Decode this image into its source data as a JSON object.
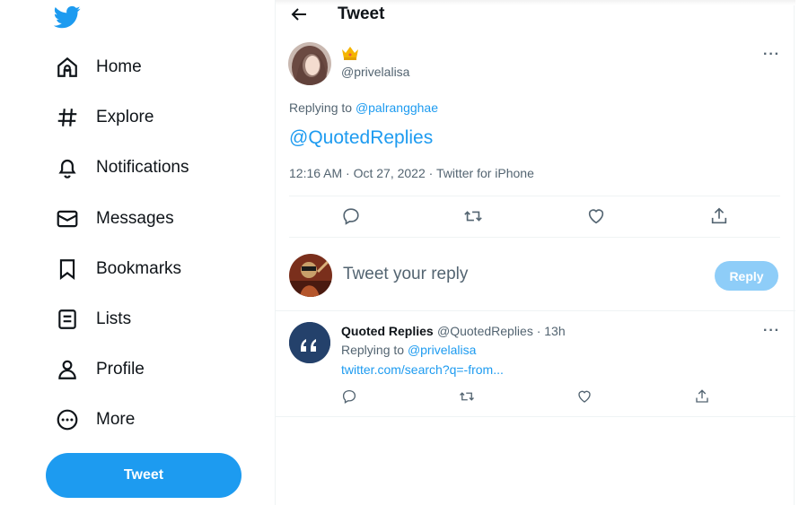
{
  "colors": {
    "brand": "#1d9bf0",
    "text": "#0f1419",
    "muted": "#536471",
    "reply_disabled": "#8ecdf8"
  },
  "sidebar": {
    "logo_icon": "twitter-bird-icon",
    "items": [
      {
        "label": "Home",
        "icon": "home-icon"
      },
      {
        "label": "Explore",
        "icon": "hashtag-icon"
      },
      {
        "label": "Notifications",
        "icon": "bell-icon"
      },
      {
        "label": "Messages",
        "icon": "envelope-icon"
      },
      {
        "label": "Bookmarks",
        "icon": "bookmark-icon"
      },
      {
        "label": "Lists",
        "icon": "list-icon"
      },
      {
        "label": "Profile",
        "icon": "person-icon"
      },
      {
        "label": "More",
        "icon": "more-circle-icon"
      }
    ],
    "tweet_button": "Tweet"
  },
  "header": {
    "back_icon": "back-arrow-icon",
    "title": "Tweet"
  },
  "tweet": {
    "display_name_emoji": "crown-emoji",
    "handle": "@privelalisa",
    "replying_prefix": "Replying to",
    "replying_to": "@palrangghae",
    "body": "@QuotedReplies",
    "timestamp": "12:16 AM · Oct 27, 2022 · Twitter for iPhone",
    "actions": [
      "reply-icon",
      "retweet-icon",
      "like-icon",
      "share-icon"
    ]
  },
  "composer": {
    "placeholder": "Tweet your reply",
    "reply_button": "Reply"
  },
  "reply": {
    "name": "Quoted Replies",
    "handle_time": "@QuotedReplies · 13h",
    "replying_prefix": "Replying to",
    "replying_to": "@privelalisa",
    "link": "twitter.com/search?q=-from..."
  }
}
